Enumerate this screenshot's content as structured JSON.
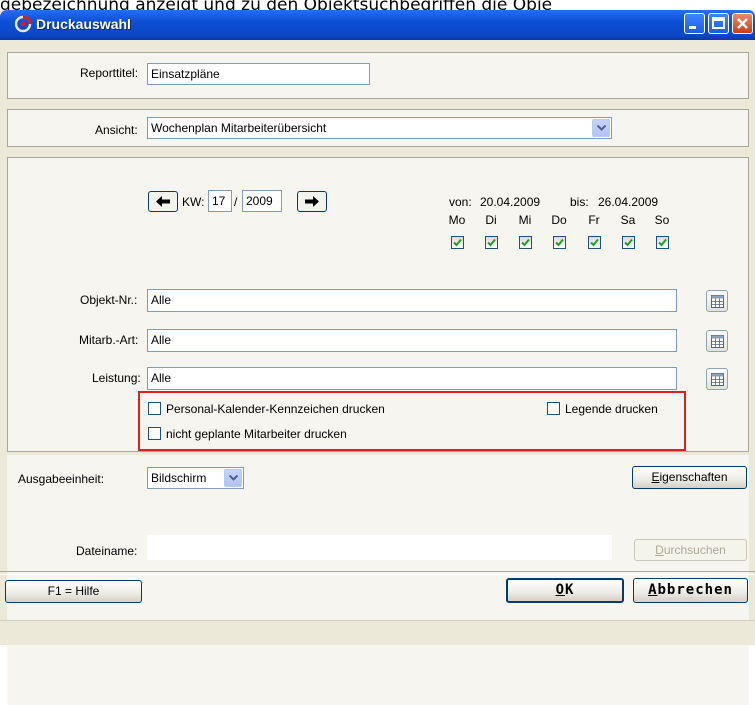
{
  "top_caption": "gebezeichnung anzeigt und zu den Objektsuchbegriffen die Obje",
  "window": {
    "title": "Druckauswahl"
  },
  "report": {
    "label": "Reporttitel:",
    "value": "Einsatzpläne"
  },
  "view": {
    "label": "Ansicht:",
    "value": "Wochenplan Mitarbeiterübersicht"
  },
  "week": {
    "kw_label": "KW:",
    "kw_value": "17",
    "separator": "/",
    "year_value": "2009",
    "from_label": "von:",
    "from_date": "20.04.2009",
    "to_label": "bis:",
    "to_date": "26.04.2009",
    "days": [
      {
        "label": "Mo",
        "checked": true
      },
      {
        "label": "Di",
        "checked": true
      },
      {
        "label": "Mi",
        "checked": true
      },
      {
        "label": "Do",
        "checked": true
      },
      {
        "label": "Fr",
        "checked": true
      },
      {
        "label": "Sa",
        "checked": true
      },
      {
        "label": "So",
        "checked": true
      }
    ]
  },
  "filters": {
    "objekt": {
      "label": "Objekt-Nr.:",
      "value": "Alle"
    },
    "mitarb": {
      "label": "Mitarb.-Art:",
      "value": "Alle"
    },
    "leistung": {
      "label": "Leistung:",
      "value": "Alle"
    }
  },
  "options": {
    "personal_kalender": {
      "label": "Personal-Kalender-Kennzeichen drucken",
      "checked": false
    },
    "legende": {
      "label": "Legende drucken",
      "checked": false
    },
    "nicht_geplant": {
      "label": "nicht geplante Mitarbeiter drucken",
      "checked": false
    }
  },
  "output": {
    "label": "Ausgabeeinheit:",
    "value": "Bildschirm",
    "properties_first": "E",
    "properties_rest": "igenschaften",
    "file_label": "Dateiname:",
    "file_value": "",
    "browse_first": "D",
    "browse_rest": "urchsuchen"
  },
  "footer": {
    "help": "F1 = Hilfe",
    "ok_first": "O",
    "ok_rest": "K",
    "cancel_first": "A",
    "cancel_rest": "bbrechen"
  },
  "colors": {
    "title_bar": "#0b4fd4",
    "highlight_box": "#e02020",
    "window_bg": "#ece9d8"
  }
}
